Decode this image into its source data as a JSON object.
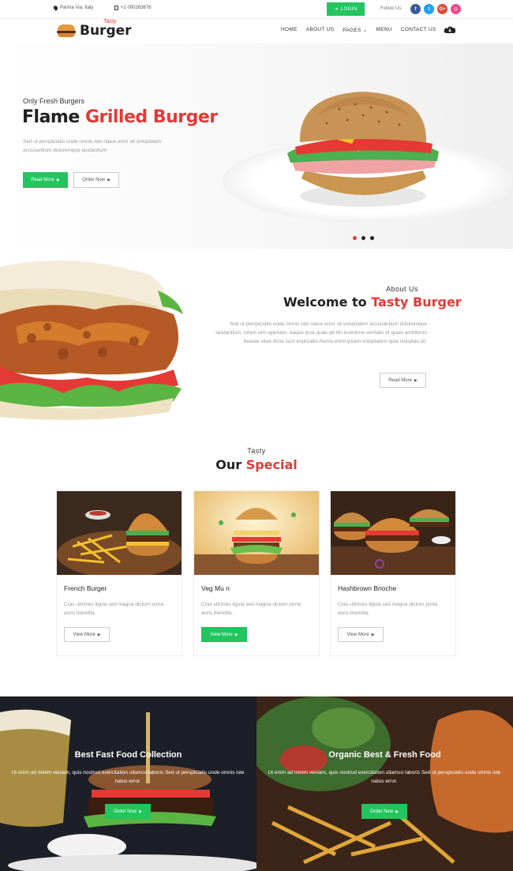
{
  "topbar": {
    "location": "Parma Via, Italy",
    "phone": "+1 000263676",
    "login_label": "LOGIN",
    "follow_label": "Follow Us:",
    "social": [
      {
        "icon": "facebook-icon",
        "glyph": "f",
        "color": "#3b5998"
      },
      {
        "icon": "twitter-icon",
        "glyph": "t",
        "color": "#1da1f2"
      },
      {
        "icon": "google-plus-icon",
        "glyph": "G+",
        "color": "#dd4b39"
      },
      {
        "icon": "dribbble-icon",
        "glyph": "◎",
        "color": "#ea4c89"
      }
    ]
  },
  "brand": {
    "small": "Tasty",
    "big": "Burger"
  },
  "nav": {
    "items": [
      "HOME",
      "ABOUT US",
      "PAGES",
      "MENU",
      "CONTACT US"
    ]
  },
  "hero": {
    "eyebrow": "Only Fresh Burgers",
    "title_a": "Flame",
    "title_b": "Grilled Burger",
    "desc": "Sed ut perspiciatis unde omnis iste natus error sit voluptatem accusantium doloremque laudantium",
    "btn_primary": "Read More",
    "btn_secondary": "Order Now"
  },
  "about": {
    "eyebrow": "About Us",
    "title_a": "Welcome to",
    "title_b": "Tasty Burger",
    "desc": "Sed ut perspiciatis unde omnis iste natus error sit voluptatem accusantium doloremque laudantium, totam rem aperiam, eaque ipsa quae ab illo inventore veritatis et quasi architecto beatae vitae dicta sunt explicabo.Nemo enim ipsam voluptatem quia voluptas sit.",
    "btn": "Read More"
  },
  "special": {
    "eyebrow": "Tasty",
    "title_a": "Our",
    "title_b": "Special",
    "cards": [
      {
        "title": "French Burger",
        "desc": "Cras ultricies ligula sed magna dictum porta auris blandita.",
        "btn": "View More"
      },
      {
        "title": "Veg Mu n",
        "desc": "Cras ultricies ligula sed magna dictum porta auris blandita.",
        "btn": "View More"
      },
      {
        "title": "Hashbrown Brioche",
        "desc": "Cras ultricies ligula sed magna dictum porta auris blandita.",
        "btn": "View More"
      }
    ]
  },
  "banners": [
    {
      "title": "Best Fast Food Collection",
      "desc": "Ut enim ad minim veniam, quis nostrud exercitation ullamco laboris Sed ut perspiciatis unde omnis iste natus error.",
      "btn": "Order Now"
    },
    {
      "title": "Organic Best & Fresh Food",
      "desc": "Ut enim ad minim veniam, quis nostrud exercitation ullamco laboris Sed ut perspiciatis unde omnis iste natus error.",
      "btn": "Order Now"
    }
  ],
  "colors": {
    "accent_green": "#22c55e",
    "accent_red": "#e53935"
  }
}
